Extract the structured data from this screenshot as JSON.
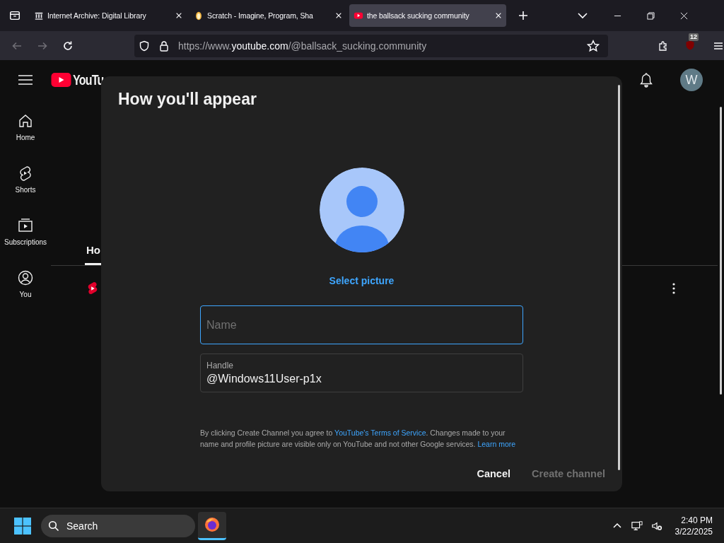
{
  "browser": {
    "tabs": [
      {
        "title": "Internet Archive: Digital Library",
        "kind": "archive",
        "selected": false
      },
      {
        "title": "Scratch - Imagine, Program, Sha",
        "kind": "scratch",
        "selected": false
      },
      {
        "title": "the ballsack sucking community",
        "kind": "video",
        "selected": true
      }
    ],
    "url": "https://www.**youtube.com**/@ballsack_sucking.community",
    "extensions_badge": "12"
  },
  "youtube": {
    "logo": "YouTu",
    "avatar_letter": "W",
    "sidebar": [
      {
        "label": "Home",
        "kind": "home"
      },
      {
        "label": "Shorts",
        "kind": "shorts"
      },
      {
        "label": "Subscriptions",
        "kind": "subscriptions"
      },
      {
        "label": "You",
        "kind": "you"
      }
    ],
    "channel_tabs": [
      {
        "label": "Ho",
        "selected": true
      }
    ]
  },
  "dialog": {
    "title": "How you'll appear",
    "select_picture": "Select picture",
    "name_field": {
      "placeholder": "Name",
      "focused": true
    },
    "handle_field": {
      "label": "Handle",
      "value": "@Windows11User-p1x"
    },
    "disclaimer": {
      "before": "By clicking Create Channel you agree to ",
      "terms_link": "YouTube's Terms of Service",
      "middle": ". Changes made to your name and profile picture are visible only on YouTube and not other Google services. ",
      "learn_more_link": "Learn more"
    },
    "buttons": [
      {
        "label": "Cancel",
        "disabled": false
      },
      {
        "label": "Create channel",
        "disabled": true
      }
    ]
  },
  "taskbar": {
    "search": "Search",
    "time": "2:40 PM",
    "date": "3/22/2025"
  }
}
